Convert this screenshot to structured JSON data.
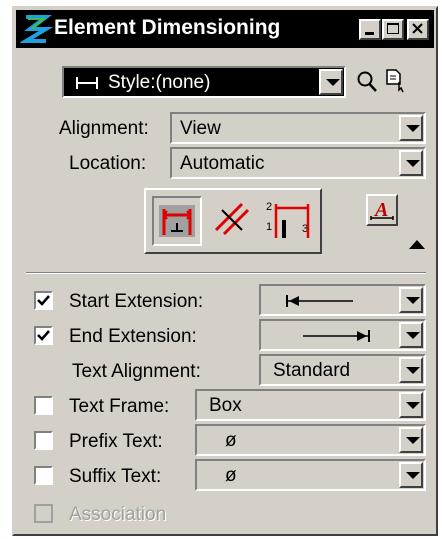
{
  "window": {
    "title": "Element Dimensioning"
  },
  "style": {
    "label": "Style:(none)"
  },
  "fields": {
    "alignment": {
      "label": "Alignment:",
      "value": "View"
    },
    "location": {
      "label": "Location:",
      "value": "Automatic"
    }
  },
  "icons": {
    "app": "microstation-logo-icon",
    "search": "magnifier-icon",
    "style_menu": "page-cursor-icon",
    "dim_mode_1": "dimension-extension-icon",
    "dim_mode_2": "dimension-slash-icon",
    "dim_mode_3": "dimension-stacked-icon",
    "text_settings": "text-style-icon",
    "collapse": "triangle-up-icon"
  },
  "options": [
    {
      "key": "start_ext",
      "label": "Start Extension:",
      "checked": true,
      "value_icon": "arrow-left-terminator-icon"
    },
    {
      "key": "end_ext",
      "label": "End Extension:",
      "checked": true,
      "value_icon": "arrow-right-terminator-icon"
    },
    {
      "key": "text_align",
      "label": "Text Alignment:",
      "value": "Standard"
    },
    {
      "key": "text_frame",
      "label": "Text Frame:",
      "checked": false,
      "value": "Box"
    },
    {
      "key": "prefix",
      "label": "Prefix Text:",
      "checked": false,
      "value": "ø"
    },
    {
      "key": "suffix",
      "label": "Suffix Text:",
      "checked": false,
      "value": "ø"
    },
    {
      "key": "association",
      "label": "Association",
      "checked": false,
      "disabled": true
    }
  ]
}
